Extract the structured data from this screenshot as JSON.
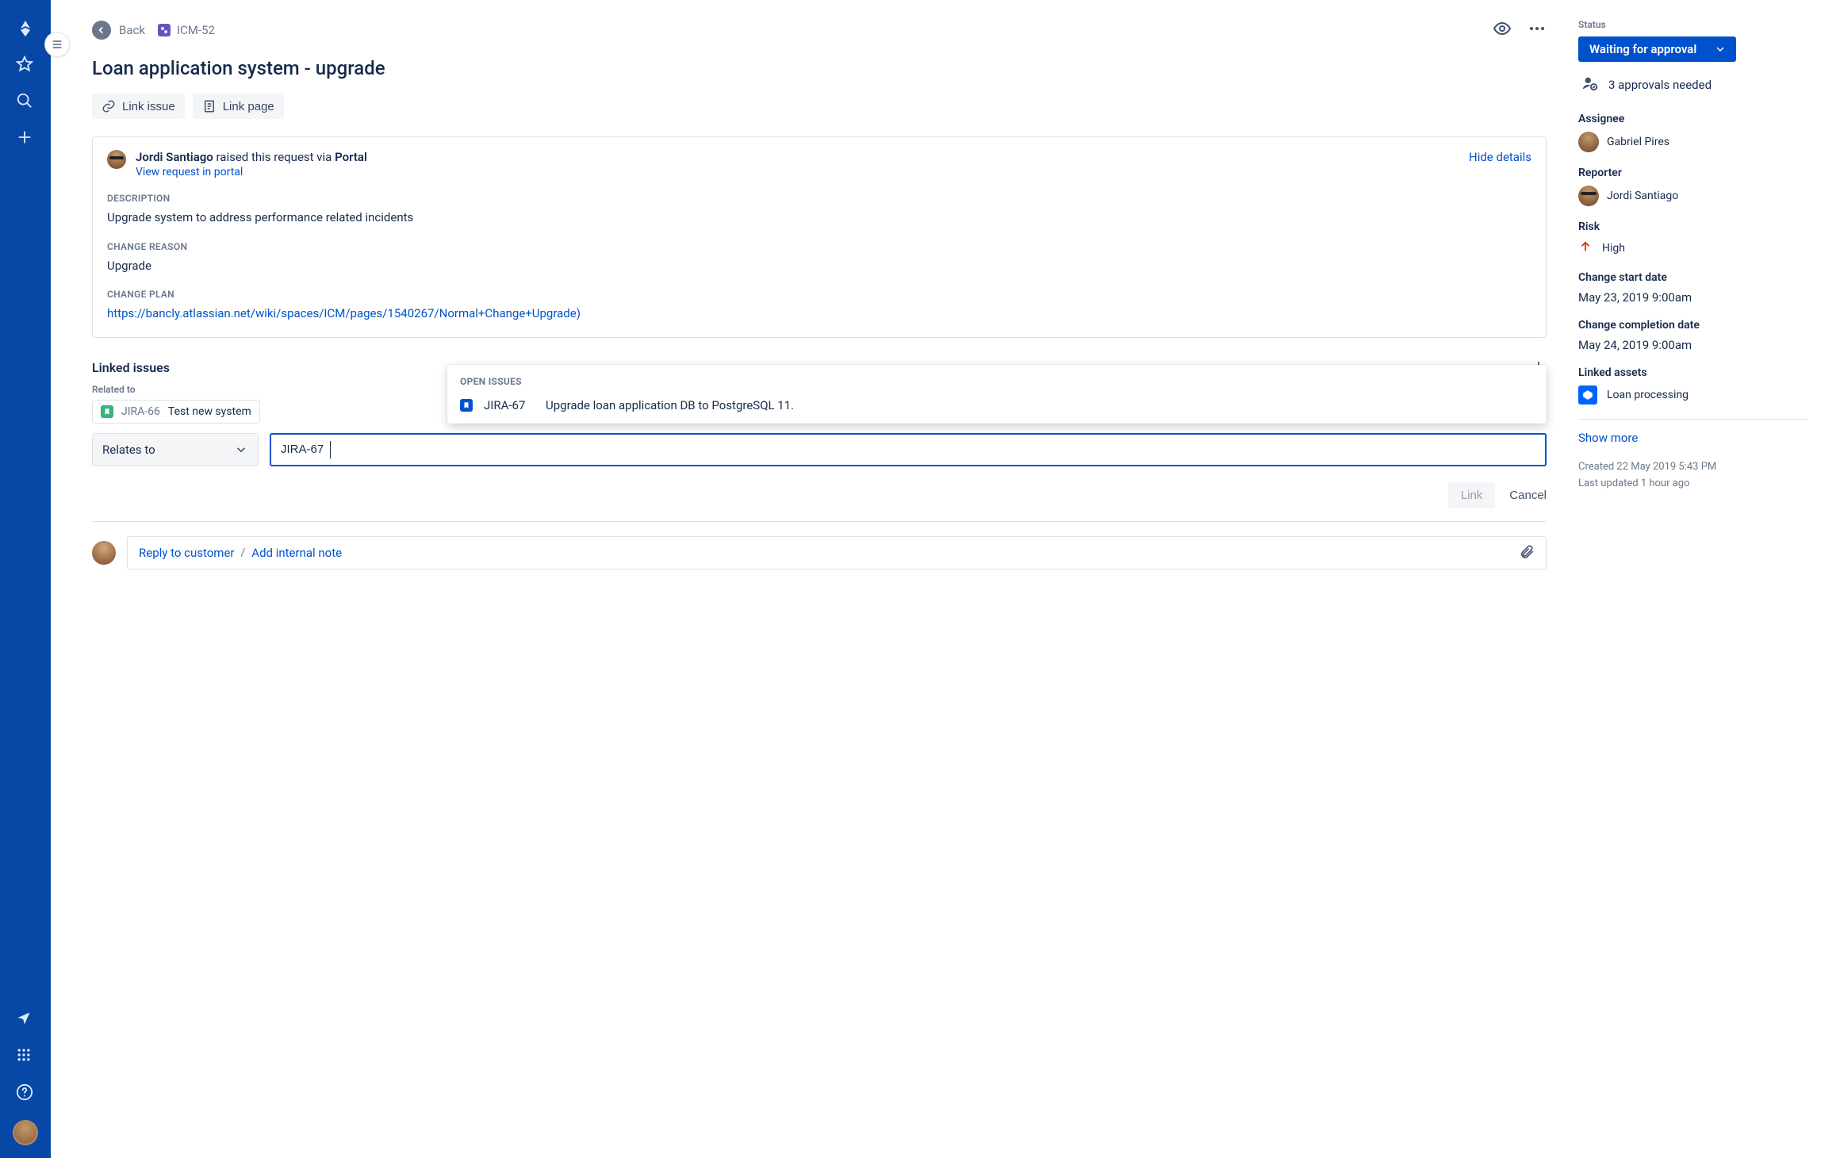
{
  "header": {
    "back": "Back",
    "issue_key": "ICM-52"
  },
  "title": "Loan application system - upgrade",
  "toolbar": {
    "link_issue": "Link issue",
    "link_page": "Link page"
  },
  "request": {
    "raised_by_name": "Jordi Santiago",
    "raised_via_mid": " raised this request via ",
    "raised_via_source": "Portal",
    "view_portal": "View request in portal",
    "hide_details": "Hide details",
    "sections": {
      "description_label": "DESCRIPTION",
      "description": "Upgrade system to address performance related incidents",
      "change_reason_label": "CHANGE REASON",
      "change_reason": "Upgrade",
      "change_plan_label": "CHANGE PLAN",
      "change_plan_url": "https://bancly.atlassian.net/wiki/spaces/ICM/pages/1540267/Normal+Change+Upgrade)"
    }
  },
  "linked": {
    "heading": "Linked issues",
    "related_label": "Related to",
    "related_item": {
      "key": "JIRA-66",
      "summary": "Test new system"
    },
    "relates_select": "Relates to",
    "search_value": "JIRA-67",
    "suggest_label": "OPEN ISSUES",
    "suggest_item": {
      "key": "JIRA-67",
      "summary": "Upgrade loan application DB to PostgreSQL 11."
    },
    "link_btn": "Link",
    "cancel_btn": "Cancel"
  },
  "reply": {
    "reply_customer": "Reply to customer",
    "separator": "/",
    "add_note": "Add internal note"
  },
  "side": {
    "status_label": "Status",
    "status_value": "Waiting for approval",
    "approvals": "3 approvals needed",
    "assignee_label": "Assignee",
    "assignee_name": "Gabriel Pires",
    "reporter_label": "Reporter",
    "reporter_name": "Jordi Santiago",
    "risk_label": "Risk",
    "risk_value": "High",
    "start_label": "Change start date",
    "start_value": "May 23, 2019 9:00am",
    "complete_label": "Change completion date",
    "complete_value": "May 24, 2019 9:00am",
    "assets_label": "Linked assets",
    "asset_name": "Loan processing",
    "show_more": "Show more",
    "created": "Created 22 May 2019 5:43 PM",
    "updated": "Last updated 1 hour ago"
  }
}
